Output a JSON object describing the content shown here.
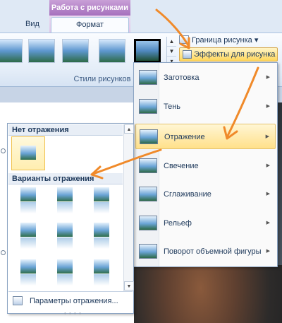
{
  "ribbon": {
    "context_group": "Работа с рисунками",
    "tab_view": "Вид",
    "tab_format": "Формат",
    "group_label": "Стили рисунков",
    "border_cmd": "Граница рисунка",
    "effects_cmd": "Эффекты для рисунка",
    "dropdown_arrow": "▾"
  },
  "effects_menu": {
    "items": [
      {
        "label": "Заготовка",
        "icon": "preset-icon"
      },
      {
        "label": "Тень",
        "icon": "shadow-icon"
      },
      {
        "label": "Отражение",
        "icon": "reflection-icon",
        "active": true
      },
      {
        "label": "Свечение",
        "icon": "glow-icon"
      },
      {
        "label": "Сглаживание",
        "icon": "soft-edges-icon"
      },
      {
        "label": "Рельеф",
        "icon": "bevel-icon"
      },
      {
        "label": "Поворот объемной фигуры",
        "icon": "3d-rotation-icon"
      }
    ],
    "submenu_arrow": "▶"
  },
  "reflection_submenu": {
    "no_reflection": "Нет отражения",
    "variants": "Варианты отражения",
    "footer": "Параметры отражения...",
    "scroll_up": "▲",
    "scroll_down": "▼",
    "grip": "• • • •"
  },
  "colors": {
    "accent_arrow": "#f08a2a",
    "context_purple": "#a670bd",
    "highlight": "#ffe08a"
  }
}
